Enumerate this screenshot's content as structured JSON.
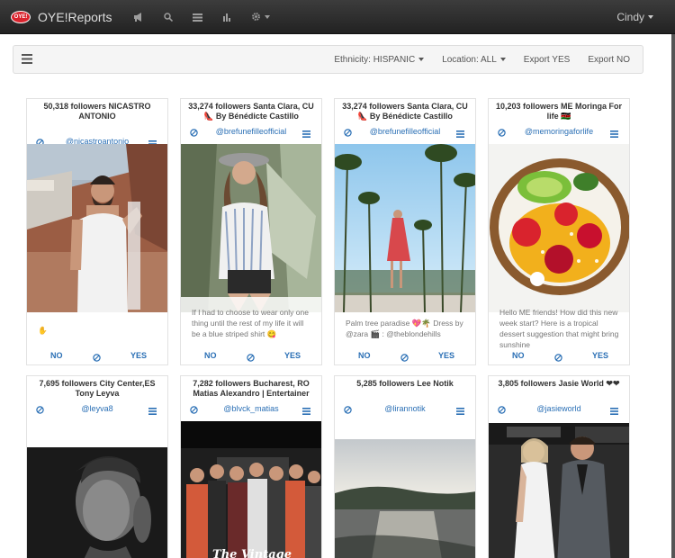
{
  "navbar": {
    "logo_text": "OYE!",
    "brand": "OYE!Reports",
    "icons": [
      "bullhorn-icon",
      "search-icon",
      "list-icon",
      "bar-chart-icon",
      "gear-icon"
    ],
    "user": "Cindy"
  },
  "filters": {
    "ethnicity": "Ethnicity: HISPANIC",
    "location": "Location: ALL",
    "export_yes": "Export YES",
    "export_no": "Export NO"
  },
  "cards": [
    {
      "title": "50,318 followers NICASTRO ANTONIO",
      "handle": "@nicastroantonio",
      "caption": "✋",
      "no": "NO",
      "yes": "YES"
    },
    {
      "title": "33,274 followers Santa Clara, CU 👠 By Bénédicte Castillo",
      "handle": "@brefunefilleofficial",
      "caption": "If I had to choose to wear only one thing until the rest of my life it will be a blue striped shirt 😋",
      "no": "NO",
      "yes": "YES"
    },
    {
      "title": "33,274 followers Santa Clara, CU 👠 By Bénédicte Castillo",
      "handle": "@brefunefilleofficial",
      "caption": "Palm tree paradise 💖🌴 Dress by @zara 🎬 : @theblondehills",
      "no": "NO",
      "yes": "YES"
    },
    {
      "title": "10,203 followers ME Moringa For life 🇰🇪",
      "handle": "@memoringaforlife",
      "caption": "Hello ME friends! How did this new week start? Here is a tropical dessert suggestion that might bring sunshine",
      "no": "NO",
      "yes": "YES"
    },
    {
      "title": "7,695 followers City Center,ES Tony Leyva",
      "handle": "@leyva8"
    },
    {
      "title": "7,282 followers Bucharest, RO Matias Alexandro | Entertainer",
      "handle": "@blvck_matias",
      "photo_text": "The Vintage"
    },
    {
      "title": "5,285 followers Lee Notik",
      "handle": "@lirannotik"
    },
    {
      "title": "3,805 followers Jasie World ❤❤",
      "handle": "@jasieworld"
    }
  ]
}
